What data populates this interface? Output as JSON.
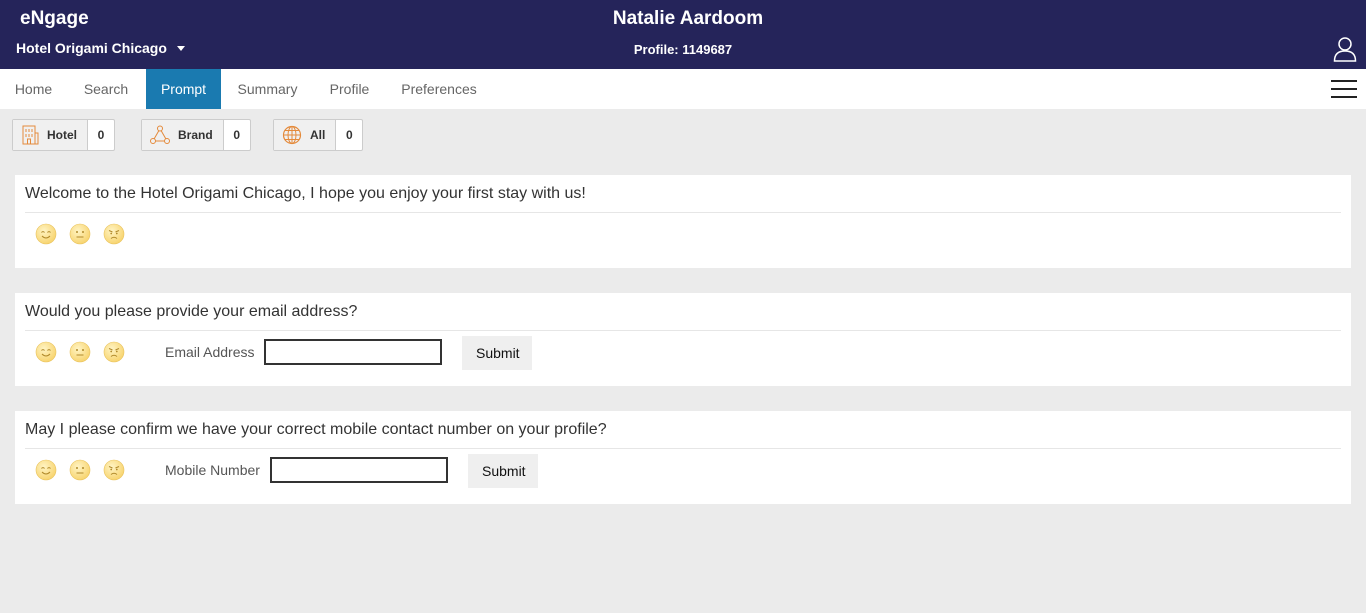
{
  "header": {
    "app_name": "eNgage",
    "hotel": "Hotel Origami Chicago",
    "guest_name": "Natalie Aardoom",
    "profile": "Profile: 1149687",
    "colors": {
      "background": "#25245a",
      "text": "#ffffff"
    }
  },
  "nav": {
    "active_color": "#1a7ab0",
    "items": [
      {
        "label": "Home"
      },
      {
        "label": "Search"
      },
      {
        "label": "Prompt"
      },
      {
        "label": "Summary"
      },
      {
        "label": "Profile"
      },
      {
        "label": "Preferences"
      }
    ]
  },
  "filters": [
    {
      "label": "Hotel",
      "count": "0",
      "icon": "building-icon"
    },
    {
      "label": "Brand",
      "count": "0",
      "icon": "network-icon"
    },
    {
      "label": "All",
      "count": "0",
      "icon": "globe-icon"
    }
  ],
  "prompts": [
    {
      "question": "Welcome to the Hotel Origami Chicago, I hope you enjoy your first stay with us!"
    },
    {
      "question": "Would you please provide your email address?",
      "field_label": "Email Address",
      "field_value": "",
      "submit": "Submit"
    },
    {
      "question": "May I please confirm we have your correct mobile contact number on your profile?",
      "field_label": "Mobile Number",
      "field_value": "",
      "submit": "Submit"
    }
  ],
  "feedback_icons": [
    "happy-face-icon",
    "neutral-face-icon",
    "angry-face-icon"
  ]
}
